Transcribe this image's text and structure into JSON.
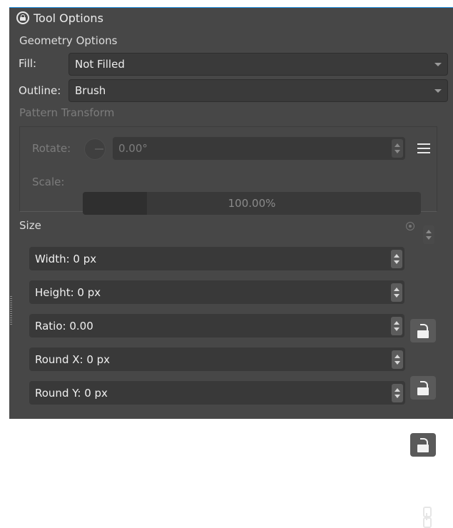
{
  "panel": {
    "title": "Tool Options",
    "title_icon": "lock-circle-icon"
  },
  "geometry": {
    "section_label": "Geometry Options",
    "fill": {
      "label": "Fill:",
      "value": "Not Filled"
    },
    "outline": {
      "label": "Outline:",
      "value": "Brush"
    }
  },
  "pattern_transform": {
    "section_label": "Pattern Transform",
    "rotate": {
      "label": "Rotate:",
      "value": "0.00°"
    },
    "scale": {
      "label": "Scale:",
      "value": "100.00%"
    }
  },
  "size": {
    "section_label": "Size",
    "width": "Width: 0 px",
    "height": "Height: 0 px",
    "ratio": "Ratio: 0.00",
    "round_x": "Round X: 0 px",
    "round_y": "Round Y: 0 px"
  }
}
